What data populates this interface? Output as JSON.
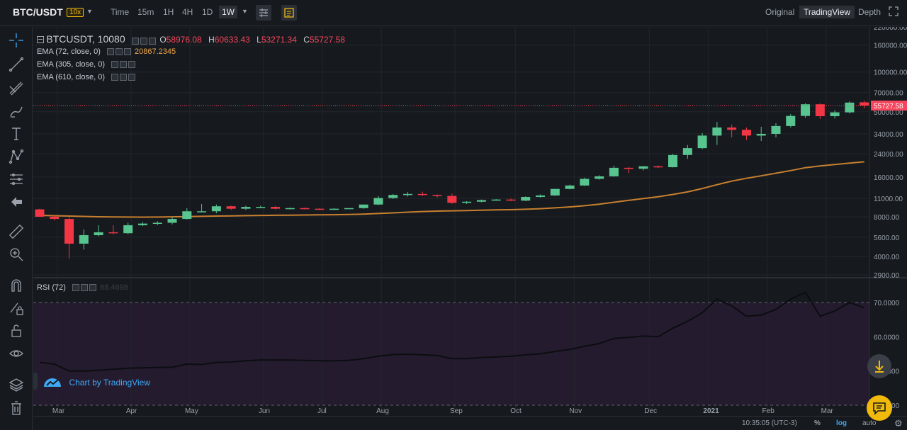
{
  "header": {
    "symbol": "BTC/USDT",
    "leverage": "10x",
    "intervals": [
      "Time",
      "15m",
      "1H",
      "4H",
      "1D",
      "1W"
    ],
    "active_interval": "1W",
    "views": [
      "Original",
      "TradingView",
      "Depth"
    ],
    "active_view": "TradingView"
  },
  "legend": {
    "symbol": "BTCUSDT, 10080",
    "open_label": "O",
    "open": "58976.08",
    "high_label": "H",
    "high": "60633.43",
    "low_label": "L",
    "low": "53271.34",
    "close_label": "C",
    "close": "55727.58",
    "ema1": "EMA (72, close, 0)",
    "ema1_value": "20867.2345",
    "ema2": "EMA (305, close, 0)",
    "ema3": "EMA (610, close, 0)",
    "rsi": "RSI (72)",
    "rsi_value": "68.4698"
  },
  "watermark": "Chart by TradingView",
  "footer": {
    "time": "10:35:05 (UTC-3)",
    "percent": "%",
    "log": "log",
    "auto": "auto"
  },
  "colors": {
    "up": "#58c48f",
    "down": "#f23645",
    "ema": "#c77f2f",
    "rsi_bg": "#241b2f",
    "last_price": "#f6465d",
    "accent": "#f0b90b"
  },
  "chart_data": [
    {
      "type": "candlestick",
      "title": "BTCUSDT, 10080",
      "scale": "log",
      "ylim": [
        2900,
        220000
      ],
      "yticks": [
        "220000.00",
        "160000.00",
        "100000.00",
        "70000.00",
        "50000.00",
        "34000.00",
        "24000.00",
        "16000.00",
        "11000.00",
        "8000.00",
        "5600.00",
        "4000.00",
        "2900.00"
      ],
      "xticks": [
        "Mar",
        "Apr",
        "May",
        "Jun",
        "Jul",
        "Aug",
        "Sep",
        "Oct",
        "Nov",
        "Dec",
        "2021",
        "Feb",
        "Mar"
      ],
      "last_price": "55727.58",
      "candles": [
        {
          "o": 9100,
          "h": 9200,
          "l": 8000,
          "c": 8000
        },
        {
          "o": 8000,
          "h": 8200,
          "l": 7500,
          "c": 7700
        },
        {
          "o": 7700,
          "h": 7900,
          "l": 3850,
          "c": 5000
        },
        {
          "o": 5000,
          "h": 6400,
          "l": 4500,
          "c": 5800
        },
        {
          "o": 5800,
          "h": 6900,
          "l": 5700,
          "c": 6100
        },
        {
          "o": 6100,
          "h": 6900,
          "l": 5900,
          "c": 6000
        },
        {
          "o": 6000,
          "h": 7200,
          "l": 5900,
          "c": 6900
        },
        {
          "o": 6900,
          "h": 7300,
          "l": 6800,
          "c": 7100
        },
        {
          "o": 7100,
          "h": 7400,
          "l": 6900,
          "c": 7200
        },
        {
          "o": 7200,
          "h": 8000,
          "l": 7000,
          "c": 7700
        },
        {
          "o": 7700,
          "h": 9300,
          "l": 7600,
          "c": 8800
        },
        {
          "o": 8800,
          "h": 10000,
          "l": 8700,
          "c": 8800
        },
        {
          "o": 8800,
          "h": 9900,
          "l": 8500,
          "c": 9600
        },
        {
          "o": 9600,
          "h": 9700,
          "l": 9000,
          "c": 9200
        },
        {
          "o": 9200,
          "h": 9700,
          "l": 9000,
          "c": 9500
        },
        {
          "o": 9500,
          "h": 9700,
          "l": 9300,
          "c": 9500
        },
        {
          "o": 9500,
          "h": 9600,
          "l": 9100,
          "c": 9200
        },
        {
          "o": 9200,
          "h": 9400,
          "l": 9100,
          "c": 9300
        },
        {
          "o": 9300,
          "h": 9400,
          "l": 9100,
          "c": 9200
        },
        {
          "o": 9200,
          "h": 9300,
          "l": 9000,
          "c": 9100
        },
        {
          "o": 9100,
          "h": 9300,
          "l": 9000,
          "c": 9200
        },
        {
          "o": 9200,
          "h": 9300,
          "l": 9100,
          "c": 9300
        },
        {
          "o": 9300,
          "h": 9900,
          "l": 9200,
          "c": 9900
        },
        {
          "o": 9900,
          "h": 11500,
          "l": 9800,
          "c": 11100
        },
        {
          "o": 11100,
          "h": 11900,
          "l": 10900,
          "c": 11700
        },
        {
          "o": 11700,
          "h": 12300,
          "l": 11400,
          "c": 11900
        },
        {
          "o": 11900,
          "h": 12400,
          "l": 11500,
          "c": 11700
        },
        {
          "o": 11700,
          "h": 11800,
          "l": 11200,
          "c": 11500
        },
        {
          "o": 11500,
          "h": 12000,
          "l": 10000,
          "c": 10200
        },
        {
          "o": 10200,
          "h": 10500,
          "l": 10000,
          "c": 10400
        },
        {
          "o": 10400,
          "h": 10800,
          "l": 10300,
          "c": 10700
        },
        {
          "o": 10700,
          "h": 10900,
          "l": 10600,
          "c": 10800
        },
        {
          "o": 10800,
          "h": 11000,
          "l": 10500,
          "c": 10600
        },
        {
          "o": 10600,
          "h": 11400,
          "l": 10500,
          "c": 11300
        },
        {
          "o": 11300,
          "h": 11800,
          "l": 11200,
          "c": 11600
        },
        {
          "o": 11600,
          "h": 12800,
          "l": 11500,
          "c": 13000
        },
        {
          "o": 13000,
          "h": 14000,
          "l": 12900,
          "c": 13800
        },
        {
          "o": 13800,
          "h": 15800,
          "l": 13700,
          "c": 15500
        },
        {
          "o": 15500,
          "h": 16500,
          "l": 15300,
          "c": 16200
        },
        {
          "o": 16200,
          "h": 19500,
          "l": 16100,
          "c": 18800
        },
        {
          "o": 18800,
          "h": 19000,
          "l": 17100,
          "c": 18500
        },
        {
          "o": 18500,
          "h": 19400,
          "l": 18000,
          "c": 19300
        },
        {
          "o": 19300,
          "h": 19600,
          "l": 18700,
          "c": 19000
        },
        {
          "o": 19000,
          "h": 24000,
          "l": 18900,
          "c": 23500
        },
        {
          "o": 23500,
          "h": 28000,
          "l": 22000,
          "c": 26500
        },
        {
          "o": 26500,
          "h": 34500,
          "l": 26000,
          "c": 33000
        },
        {
          "o": 33000,
          "h": 41900,
          "l": 28000,
          "c": 38000
        },
        {
          "o": 38000,
          "h": 40000,
          "l": 32000,
          "c": 36500
        },
        {
          "o": 36500,
          "h": 38000,
          "l": 30500,
          "c": 33000
        },
        {
          "o": 33000,
          "h": 38500,
          "l": 30000,
          "c": 34000
        },
        {
          "o": 34000,
          "h": 41000,
          "l": 32000,
          "c": 39000
        },
        {
          "o": 39000,
          "h": 48000,
          "l": 38000,
          "c": 46500
        },
        {
          "o": 46500,
          "h": 58000,
          "l": 45000,
          "c": 57000
        },
        {
          "o": 57000,
          "h": 58000,
          "l": 44000,
          "c": 46300
        },
        {
          "o": 46300,
          "h": 51500,
          "l": 44500,
          "c": 49500
        },
        {
          "o": 49500,
          "h": 60000,
          "l": 48500,
          "c": 58700
        },
        {
          "o": 58976.08,
          "h": 60633.43,
          "l": 53271.34,
          "c": 55727.58
        }
      ],
      "series": [
        {
          "name": "EMA (72, close, 0)",
          "values": [
            8200,
            8150,
            8100,
            8050,
            8000,
            7980,
            7960,
            7950,
            7960,
            7990,
            8020,
            8060,
            8100,
            8130,
            8160,
            8190,
            8210,
            8230,
            8250,
            8270,
            8290,
            8320,
            8370,
            8460,
            8560,
            8660,
            8760,
            8830,
            8870,
            8910,
            8960,
            9010,
            9050,
            9120,
            9210,
            9340,
            9500,
            9700,
            9950,
            10300,
            10650,
            11000,
            11330,
            11800,
            12350,
            13100,
            14000,
            14900,
            15650,
            16350,
            17100,
            17900,
            18850,
            19400,
            19900,
            20400,
            20867
          ]
        }
      ]
    },
    {
      "type": "line",
      "title": "RSI (72)",
      "ylim": [
        40,
        76
      ],
      "yticks": [
        "70.0000",
        "60.0000",
        "50.0000",
        "40.0000"
      ],
      "levels": [
        70,
        40
      ],
      "series": [
        {
          "name": "RSI (72)",
          "values": [
            52.5,
            52.0,
            50.0,
            50.0,
            50.2,
            50.5,
            50.8,
            50.9,
            51.0,
            51.1,
            52.0,
            51.9,
            52.5,
            52.6,
            53.0,
            53.2,
            53.2,
            53.2,
            53.1,
            53.0,
            53.0,
            53.1,
            53.6,
            54.3,
            54.8,
            54.9,
            54.7,
            54.5,
            53.6,
            53.6,
            53.9,
            54.1,
            54.3,
            54.7,
            55.0,
            55.7,
            56.3,
            57.2,
            58.0,
            59.5,
            59.8,
            60.2,
            60.0,
            62.5,
            64.5,
            67.0,
            71.0,
            69.0,
            66.0,
            66.3,
            68.0,
            71.0,
            73.0,
            66.0,
            67.5,
            70.0,
            68.4698
          ]
        }
      ]
    }
  ]
}
